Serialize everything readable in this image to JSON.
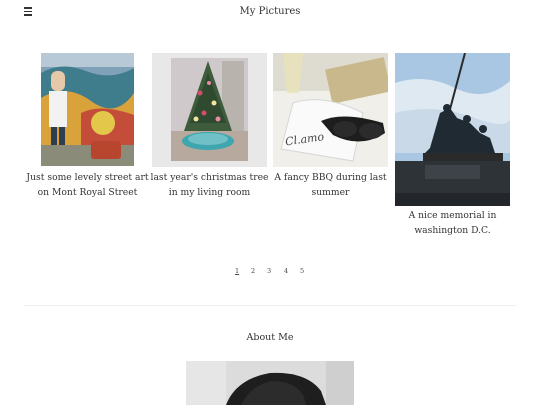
{
  "header": {
    "site_title": "My Pictures",
    "menu_icon": "hamburger-icon"
  },
  "gallery": {
    "items": [
      {
        "caption_line1": "Just some levely street art",
        "caption_line2": "on Mont Royal Street",
        "image": "street-art-mural"
      },
      {
        "caption_line1": "last year's christmas tree",
        "caption_line2": "in my living room",
        "image": "christmas-tree"
      },
      {
        "caption_line1": "A fancy BBQ during last",
        "caption_line2": "summer",
        "image": "bbq-table-sunglasses"
      },
      {
        "caption_line1": "A nice memorial in",
        "caption_line2": "washington D.C.",
        "image": "iwo-jima-memorial"
      }
    ]
  },
  "pagination": {
    "pages": [
      "1",
      "2",
      "3",
      "4",
      "5"
    ],
    "current": "1"
  },
  "about": {
    "title": "About Me",
    "image": "portrait-photo"
  },
  "colors": {
    "text": "#333333",
    "background": "#ffffff",
    "divider": "#efefef"
  }
}
